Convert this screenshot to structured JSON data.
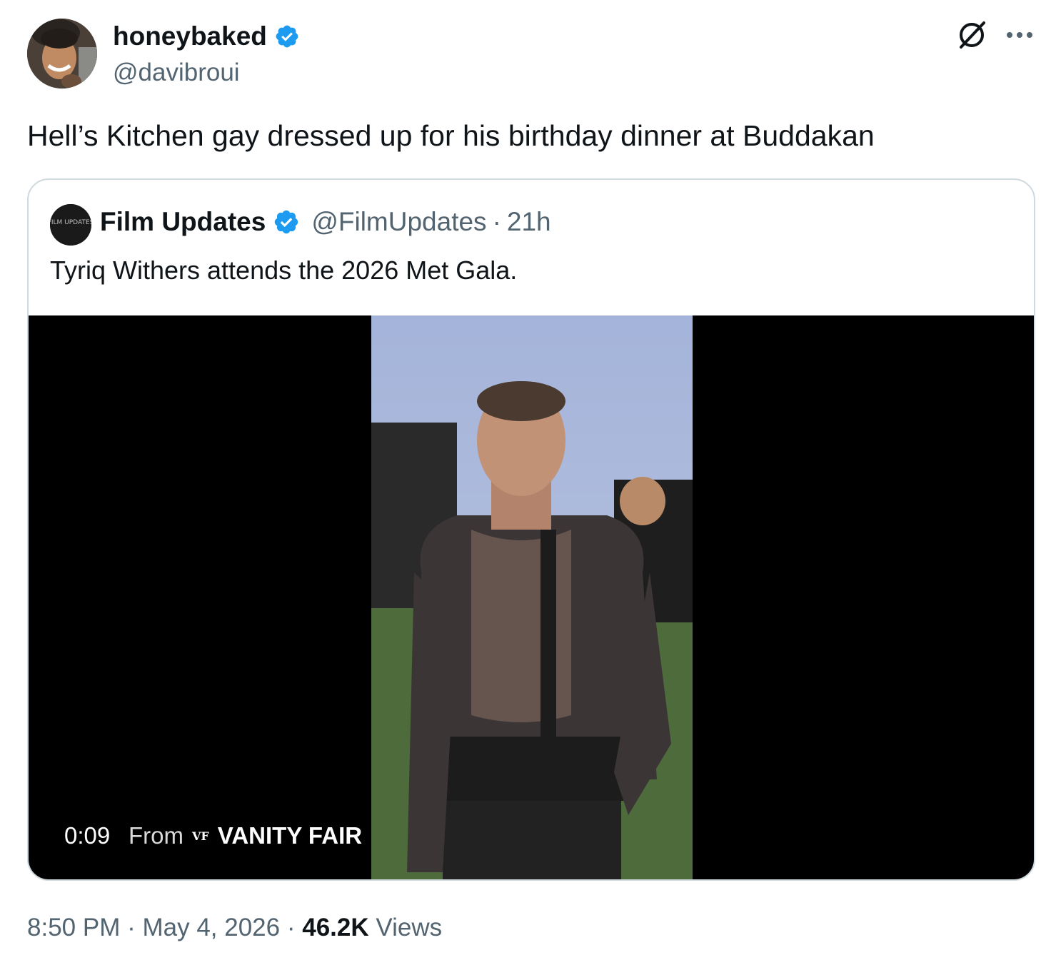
{
  "author": {
    "display_name": "honeybaked",
    "handle": "@davibroui"
  },
  "tweet": {
    "text": "Hell’s Kitchen gay dressed up for his birthday dinner at Buddakan"
  },
  "quoted": {
    "display_name": "Film Updates",
    "handle": "@FilmUpdates",
    "separator": "·",
    "age": "21h",
    "text": "Tyriq Withers attends the 2026 Met Gala.",
    "avatar_text": "FILM UPDATES",
    "video": {
      "elapsed": "0:09",
      "source_prefix": "From",
      "source_mark": "VF",
      "source_name": "VANITY FAIR"
    }
  },
  "meta": {
    "time": "8:50 PM",
    "sep1": "·",
    "date": "May 4, 2026",
    "sep2": "·",
    "views_count": "46.2K",
    "views_label": "Views"
  },
  "colors": {
    "text": "#0f1419",
    "muted": "#536471",
    "verified": "#1d9bf0",
    "border": "#cfd9de"
  },
  "icons": [
    "verified-badge-icon",
    "grok-icon",
    "more-icon"
  ]
}
